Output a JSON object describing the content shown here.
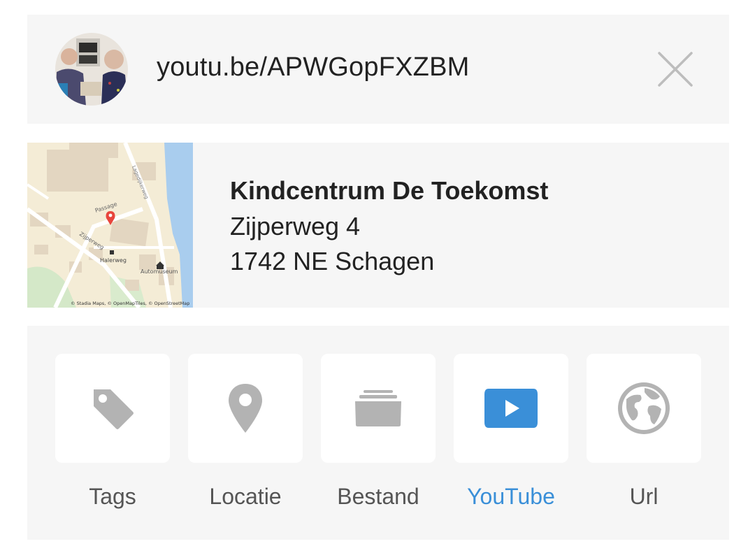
{
  "link": {
    "url": "youtu.be/APWGopFXZBM",
    "thumbnail_icon": "video-thumbnail",
    "close_icon": "close-icon"
  },
  "location": {
    "name": "Kindcentrum De Toekomst",
    "street": "Zijperweg 4",
    "city": "1742 NE Schagen",
    "map": {
      "labels": {
        "passage": "Passage",
        "zijperweg": "Zijperweg",
        "halerweg": "Halerweg",
        "automuseum": "Automuseum",
        "lagedijkerweg": "Lagedijkerweg"
      },
      "attribution": "© Stadia Maps, © OpenMapTiles, © OpenStreetMap",
      "pin_color": "#e8453c"
    }
  },
  "types": {
    "active": "youtube",
    "accent_color": "#3a8fd8",
    "inactive_color": "#b3b3b3",
    "items": [
      {
        "id": "tags",
        "label": "Tags",
        "icon": "tag-icon"
      },
      {
        "id": "locatie",
        "label": "Locatie",
        "icon": "map-pin-icon"
      },
      {
        "id": "bestand",
        "label": "Bestand",
        "icon": "folder-icon"
      },
      {
        "id": "youtube",
        "label": "YouTube",
        "icon": "youtube-icon"
      },
      {
        "id": "url",
        "label": "Url",
        "icon": "globe-icon"
      }
    ]
  }
}
